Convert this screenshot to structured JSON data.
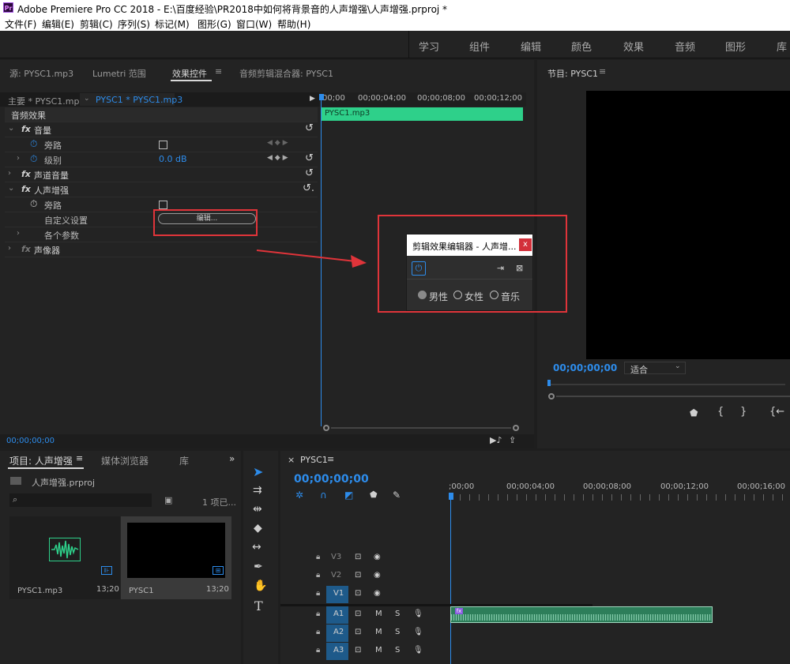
{
  "title_bar": {
    "logo": "Pr",
    "title": "Adobe Premiere Pro CC 2018 - E:\\百度经验\\PR2018中如何将背景音的人声增强\\人声增强.prproj *"
  },
  "menu": [
    "文件(F)",
    "编辑(E)",
    "剪辑(C)",
    "序列(S)",
    "标记(M)",
    "图形(G)",
    "窗口(W)",
    "帮助(H)"
  ],
  "workspaces": [
    "学习",
    "组件",
    "编辑",
    "颜色",
    "效果",
    "音频",
    "图形",
    "库"
  ],
  "effect_panel": {
    "tabs": [
      "源: PYSC1.mp3",
      "Lumetri 范围",
      "效果控件",
      "音频剪辑混合器: PYSC1"
    ],
    "master_clip": "主要 * PYSC1.mp3",
    "sequence_clip": "PYSC1 * PYSC1.mp3",
    "section_title": "音频效果",
    "rows": {
      "volume": "音量",
      "bypass": "旁路",
      "level": "级别",
      "level_value": "0.0 dB",
      "channel_volume": "声道音量",
      "vocal_enhancer": "人声增强",
      "bypass2": "旁路",
      "custom_setup": "自定义设置",
      "edit_button": "编辑...",
      "params": "各个参数",
      "panner": "声像器"
    },
    "timecode": "00;00;00;00",
    "ruler": [
      "00;00",
      "00;00;04;00",
      "00;00;08;00",
      "00;00;12;00"
    ],
    "clip_label": "PYSC1.mp3"
  },
  "dialog": {
    "title": "剪辑效果编辑器 - 人声增...",
    "close": "x",
    "options": [
      "男性",
      "女性",
      "音乐"
    ]
  },
  "program_monitor": {
    "title": "节目: PYSC1",
    "timecode": "00;00;00;00",
    "fit": "适合"
  },
  "project_panel": {
    "tabs": [
      "项目: 人声增强",
      "媒体浏览器",
      "库"
    ],
    "project_file": "人声增强.prproj",
    "item_count": "1 项已...",
    "items": [
      {
        "name": "PYSC1.mp3",
        "duration": "13;20"
      },
      {
        "name": "PYSC1",
        "duration": "13;20"
      }
    ]
  },
  "timeline": {
    "tab": "PYSC1",
    "timecode": "00;00;00;00",
    "ruler": [
      ";00;00",
      "00;00;04;00",
      "00;00;08;00",
      "00;00;12;00",
      "00;00;16;00"
    ],
    "video_tracks": [
      "V3",
      "V2",
      "V1"
    ],
    "audio_tracks": [
      "A1",
      "A2",
      "A3"
    ],
    "mute": "M",
    "solo": "S",
    "clip_fx": "fx"
  },
  "colors": {
    "accent_blue": "#2d8ceb",
    "clip_green": "#2ed08a",
    "annotation_red": "#e0343a"
  }
}
